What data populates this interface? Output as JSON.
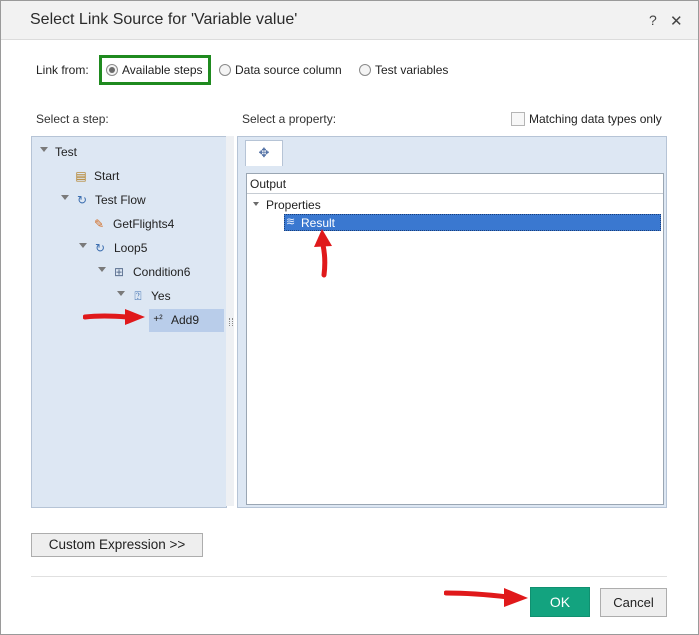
{
  "dialog": {
    "title": "Select Link Source for 'Variable value'",
    "help_label": "?",
    "close_label": "✕"
  },
  "link_from": {
    "label": "Link from:",
    "options": [
      {
        "label": "Available steps",
        "selected": true
      },
      {
        "label": "Data source column",
        "selected": false
      },
      {
        "label": "Test variables",
        "selected": false
      }
    ]
  },
  "steps": {
    "label": "Select a step:",
    "tree": [
      {
        "label": "Test",
        "icon": "none"
      },
      {
        "label": "Start",
        "icon": "start-icon"
      },
      {
        "label": "Test Flow",
        "icon": "flow-icon"
      },
      {
        "label": "GetFlights4",
        "icon": "service-icon"
      },
      {
        "label": "Loop5",
        "icon": "loop-icon"
      },
      {
        "label": "Condition6",
        "icon": "condition-icon"
      },
      {
        "label": "Yes",
        "icon": "branch-icon"
      },
      {
        "label": "Add9",
        "icon": "add-icon",
        "selected": true
      }
    ]
  },
  "properties": {
    "label": "Select a property:",
    "matching_types_label": "Matching data types only",
    "tab_icon": "link-properties-icon",
    "header": "Output",
    "group": "Properties",
    "selected_property": "Result"
  },
  "buttons": {
    "custom_expression": "Custom Expression >>",
    "ok": "OK",
    "cancel": "Cancel"
  },
  "colors": {
    "ok_button": "#13a37f",
    "selection": "#3a78d0",
    "highlight_box": "#1f8a1f",
    "annotation_arrow": "#e0191b"
  }
}
